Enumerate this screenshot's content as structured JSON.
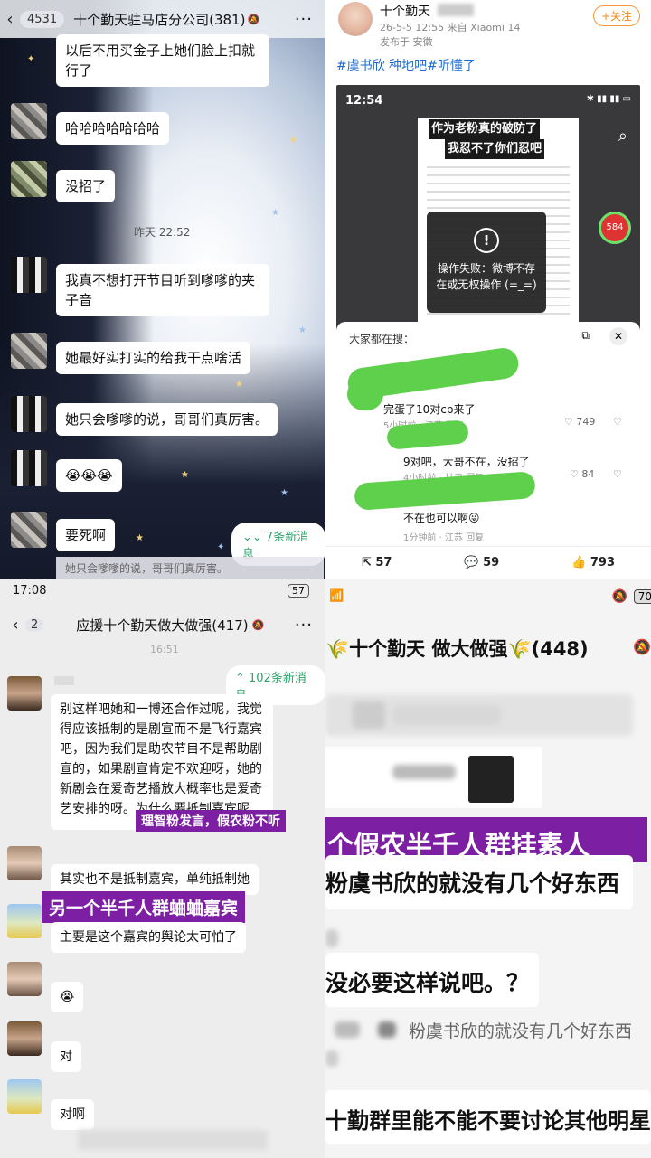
{
  "q1": {
    "back_badge": "4531",
    "title": "十个勤天驻马店分公司(381)",
    "messages": [
      "以后不用买金子上她们脸上扣就\n行了",
      "哈哈哈哈哈哈哈",
      "没招了",
      "我真不想打开节目听到嗲嗲的夹\n子音",
      "她最好实打实的给我干点啥活",
      "她只会嗲嗲的说，哥哥们真厉害。",
      "😭😭😭",
      "要死啊"
    ],
    "timestamp": "昨天 22:52",
    "new_messages": "7条新消息",
    "quote": "她只会嗲嗲的说，哥哥们真厉害。"
  },
  "q2": {
    "author": "十个勤天",
    "meta": "26-5-5 12:55  来自 Xiaomi 14",
    "location": "发布于 安徽",
    "follow": "+关注",
    "tags": "#虞书欣 种地吧#听懂了",
    "status_time": "12:54",
    "card_title_1": "作为老粉真的破防了",
    "card_title_2": "我忍不了你们忍吧",
    "toast_icon": "!",
    "toast_text": "操作失败：微博不存\n在或无权操作 (=_=)",
    "red_count": "584",
    "search_label": "大家都在搜：",
    "comments": [
      {
        "text": "完蛋了10对cp来了",
        "meta": "5小时前 · 江苏  回复",
        "likes": "749"
      },
      {
        "text": "9对吧，大哥不在，没招了",
        "meta": "4小时前 · 甘肃  回复",
        "likes": "84"
      },
      {
        "text": "不在也可以啊😜",
        "meta": "1分钟前 · 江苏  回复",
        "likes": ""
      }
    ],
    "reposts": "57",
    "comment_count": "59",
    "like_count": "793"
  },
  "q3": {
    "status_time": "17:08",
    "battery": "57",
    "back_badge": "2",
    "title": "应援十个勤天做大做强(417)",
    "time": "16:51",
    "new_messages": "102条新消息",
    "msg1": "别这样吧她和一博还合作过呢，我觉得应该抵制的是剧宣而不是飞行嘉宾吧，因为我们是助农节目不是帮助剧宣的，如果剧宣肯定不欢迎呀，她的新剧会在爱奇艺播放大概率也是爱奇艺安排的呀。为什么要抵制嘉宾呢",
    "label1": "理智粉发言，假农粉不听",
    "msg2": "其实也不是抵制嘉宾，单纯抵制她",
    "label2": "另一个半千人群蛐蛐嘉宾",
    "msg3": "主要是这个嘉宾的舆论太可怕了",
    "msg4": "😭",
    "msg5": "对",
    "msg6": "对啊"
  },
  "q4": {
    "battery": "70",
    "title": "🌾十个勤天 做大做强🌾(448)",
    "label": "个假农半千人群挂素人",
    "line1": "粉虞书欣的就没有几个好东西",
    "line2": "没必要这样说吧。？",
    "quote": "粉虞书欣的就没有几个好东西",
    "line3": "十勤群里能不能不要讨论其他明星"
  }
}
